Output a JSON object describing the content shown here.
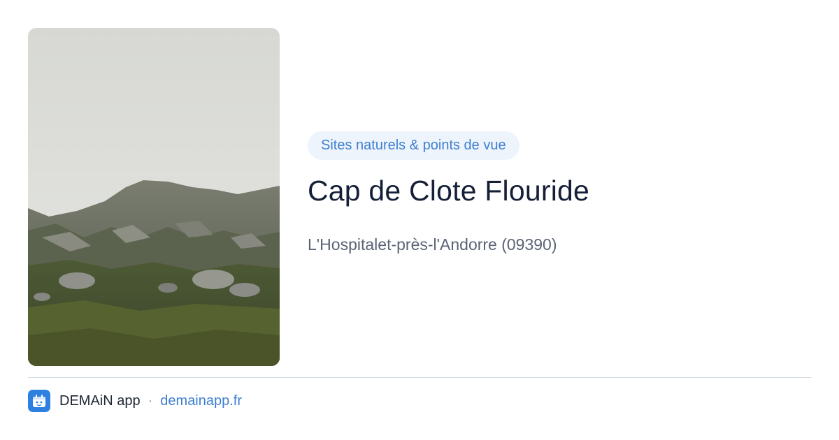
{
  "card": {
    "image_alt": "mountain-landscape",
    "category": "Sites naturels & points de vue",
    "title": "Cap de Clote Flouride",
    "location": "L'Hospitalet-près-l'Andorre (09390)"
  },
  "footer": {
    "app_icon": "app-logo-icon",
    "app_name": "DEMAiN app",
    "separator": "·",
    "domain": "demainapp.fr"
  },
  "colors": {
    "accent": "#3f7fd0",
    "tag_background": "#eef4fc",
    "title": "#152038",
    "subtitle": "#5a6475",
    "divider": "#d5dde4"
  }
}
